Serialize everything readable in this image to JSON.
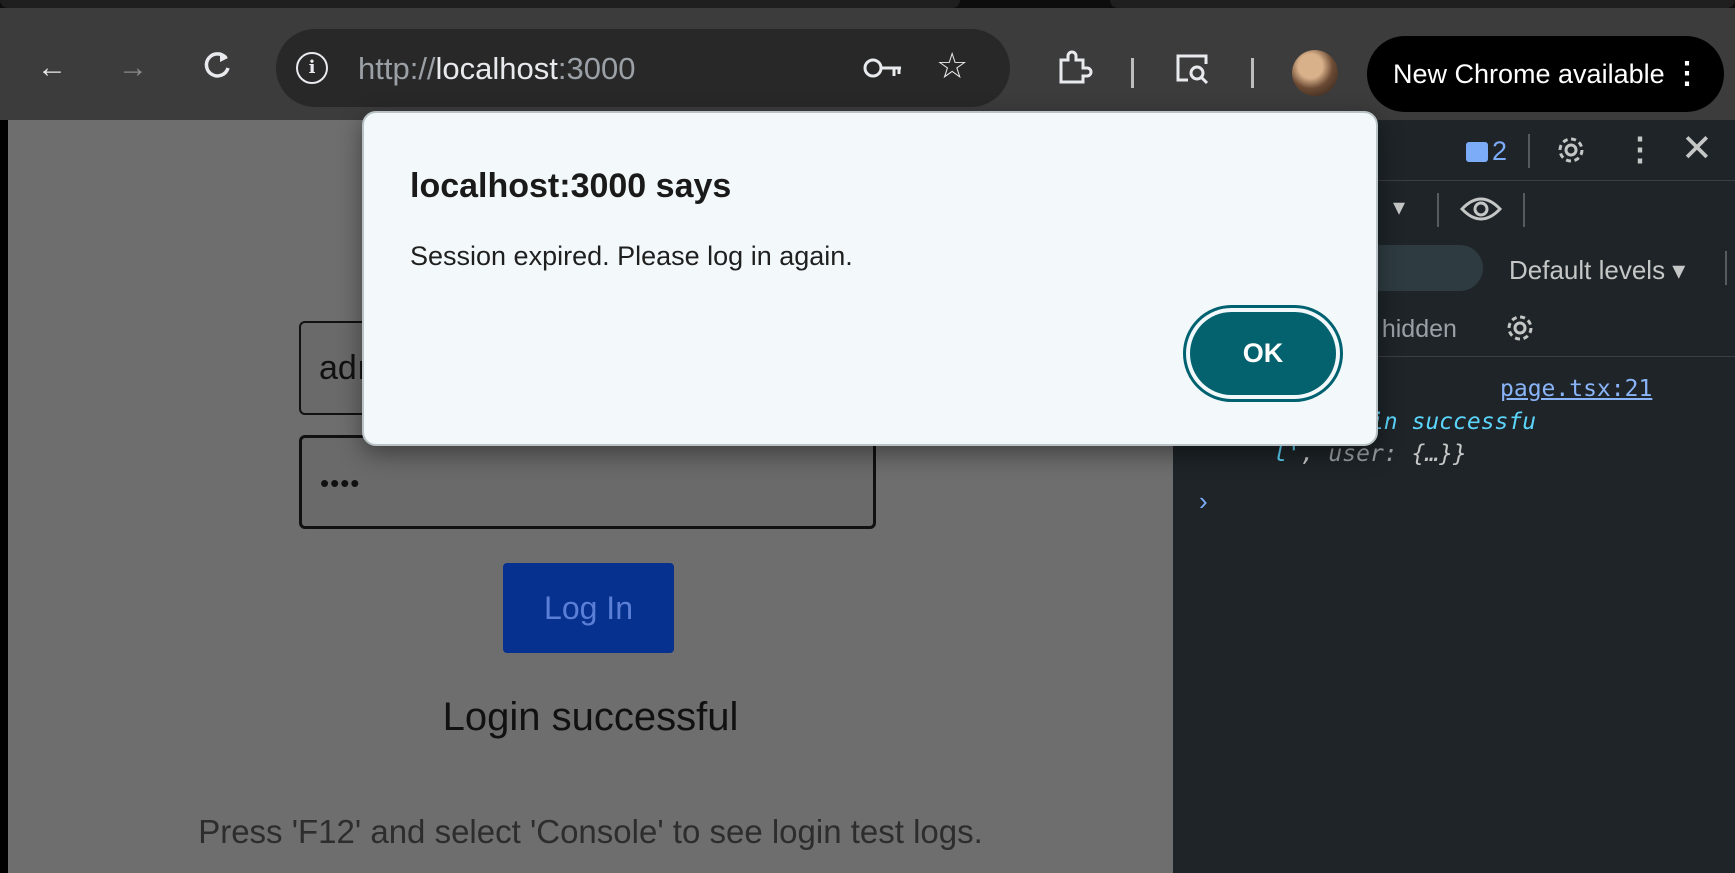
{
  "browser": {
    "url_scheme": "http://",
    "url_host": "localhost",
    "url_port": ":3000",
    "update_label": "New Chrome available",
    "update_menu_icon": "kebab-icon"
  },
  "page": {
    "username_value": "adı",
    "password_value": "••••",
    "login_button": "Log In",
    "status_text": "Login successful",
    "hint_text": "Press 'F12' and select 'Console' to see login test logs."
  },
  "devtools": {
    "message_count": "2",
    "default_levels": "Default levels ▾",
    "hidden_count": "1 hidden",
    "log_source": "page.tsx:21",
    "log_key1": "e: ",
    "log_val1": "'Login successfu",
    "log_val1b": "l'",
    "log_key2": "user: ",
    "log_obj": "{…}}",
    "prompt": "›"
  },
  "dialog": {
    "title": "localhost:3000 says",
    "message": "Session expired. Please log in again.",
    "ok_label": "OK"
  }
}
